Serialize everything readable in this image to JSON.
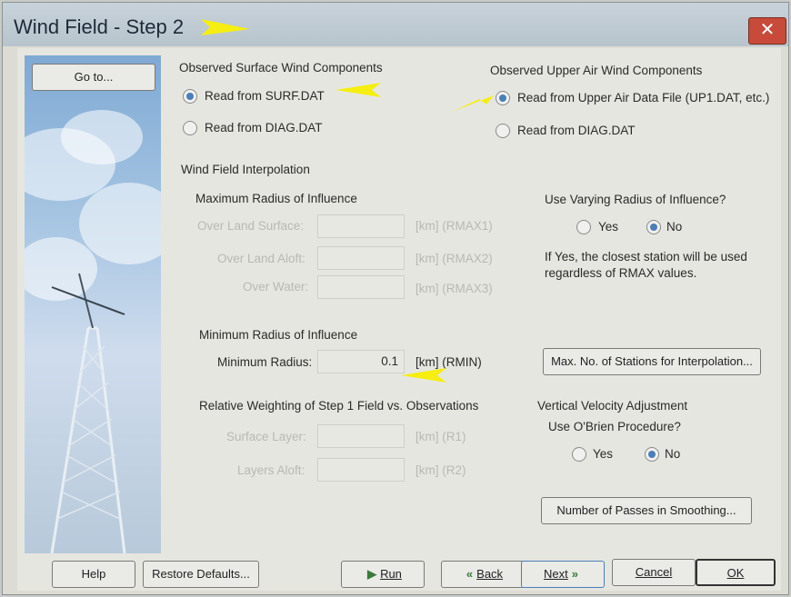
{
  "window": {
    "title": "Wind Field - Step 2",
    "close_glyph": "✕"
  },
  "sidebar": {
    "goto_label": "Go to..."
  },
  "surface": {
    "heading": "Observed Surface Wind Components",
    "opt1": "Read from SURF.DAT",
    "opt2": "Read from DIAG.DAT",
    "selected": "opt1"
  },
  "upper": {
    "heading": "Observed Upper Air Wind Components",
    "opt1": "Read from Upper Air Data File (UP1.DAT, etc.)",
    "opt2": "Read from DIAG.DAT",
    "selected": "opt1"
  },
  "interp": {
    "heading": "Wind Field Interpolation",
    "max_heading": "Maximum Radius of Influence",
    "over_land_surface": "Over Land Surface:",
    "over_land_aloft": "Over Land Aloft:",
    "over_water": "Over Water:",
    "unit_rmax1": "[km]  (RMAX1)",
    "unit_rmax2": "[km]  (RMAX2)",
    "unit_rmax3": "[km]  (RMAX3)",
    "varying_q": "Use Varying Radius of Influence?",
    "yes": "Yes",
    "no": "No",
    "varying_selected": "no",
    "note_line1": "If Yes, the closest station will be used",
    "note_line2": "regardless of RMAX values.",
    "min_heading": "Minimum Radius of Influence",
    "min_label": "Minimum Radius:",
    "min_value": "0.1",
    "unit_rmin": "[km]  (RMIN)",
    "max_stations_btn": "Max. No. of Stations for Interpolation..."
  },
  "weighting": {
    "heading": "Relative Weighting of Step 1 Field vs. Observations",
    "surface_layer": "Surface Layer:",
    "layers_aloft": "Layers Aloft:",
    "unit_r1": "[km]  (R1)",
    "unit_r2": "[km]  (R2)"
  },
  "vertical": {
    "heading": "Vertical Velocity Adjustment",
    "question": "Use O'Brien Procedure?",
    "yes": "Yes",
    "no": "No",
    "selected": "no",
    "passes_btn": "Number of Passes in Smoothing..."
  },
  "footer": {
    "help": "Help",
    "restore": "Restore Defaults...",
    "run": "Run",
    "back": "Back",
    "next": "Next",
    "cancel": "Cancel",
    "ok": "OK"
  },
  "colors": {
    "annotation_arrow": "#f5ee10",
    "radio_selected": "#4a7fb7"
  }
}
